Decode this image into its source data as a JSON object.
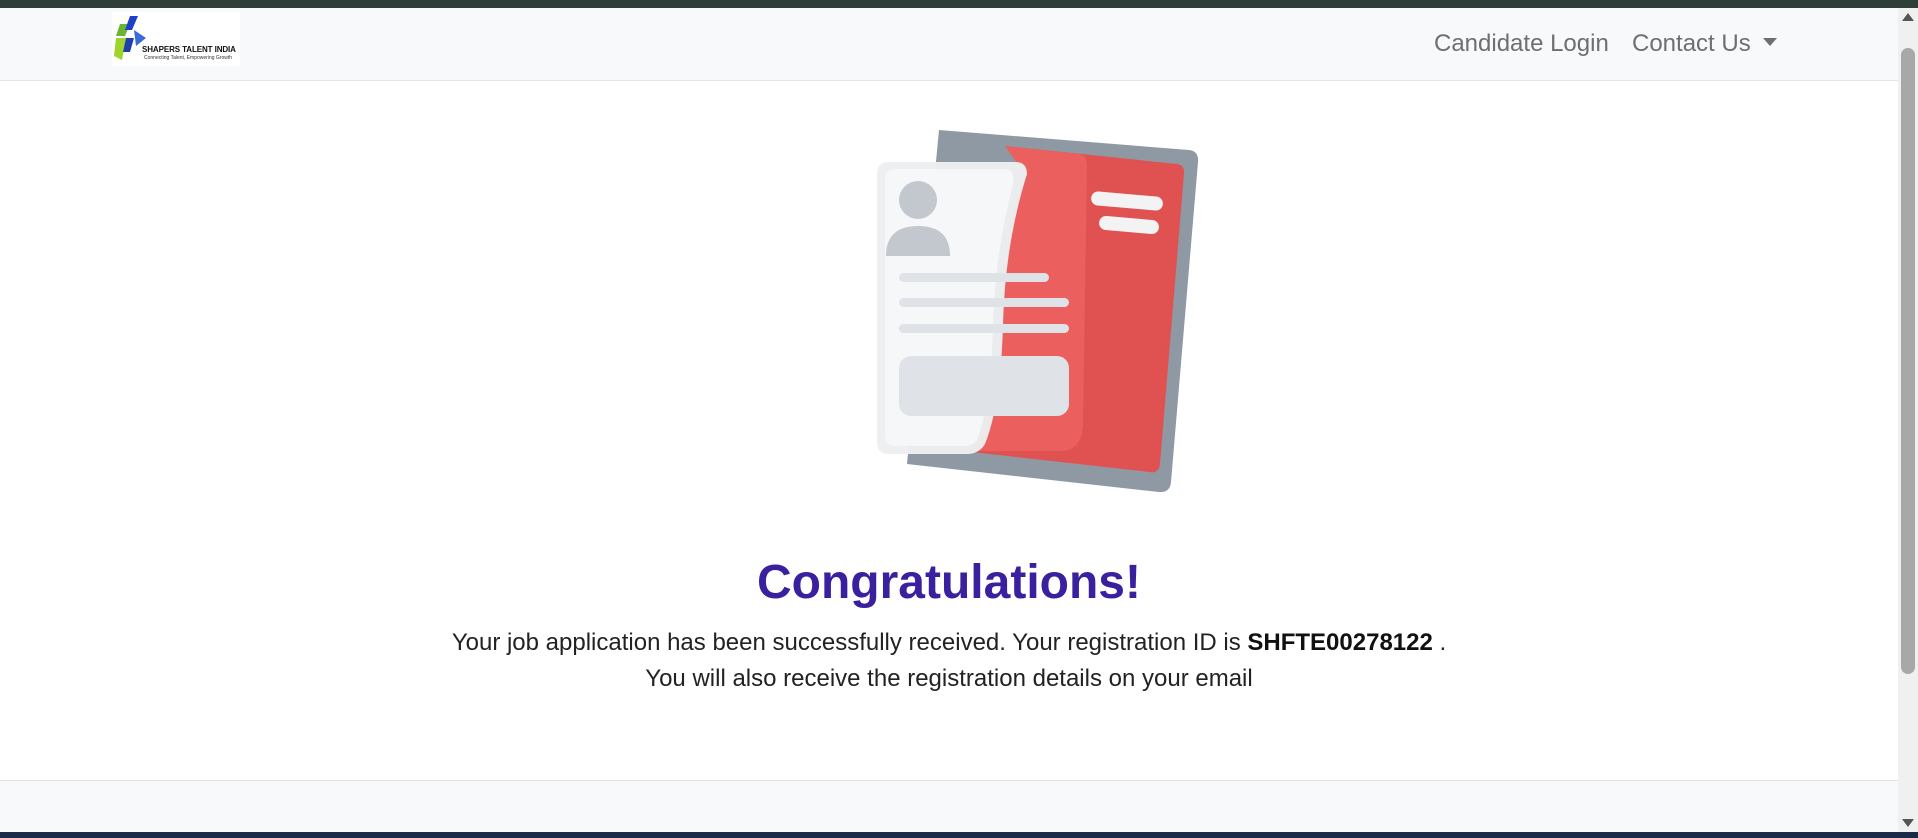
{
  "header": {
    "logo_title": "SHAPERS TALENT INDIA",
    "logo_tagline": "Connecting Talent, Empowering Growth",
    "nav": {
      "candidate_login": "Candidate Login",
      "contact_us": "Contact Us"
    }
  },
  "main": {
    "title": "Congratulations!",
    "message_prefix": "Your job application has been successfully received. Your registration ID is",
    "registration_id": "SHFTE00278122",
    "message_suffix": " .",
    "message_line2": "You will also receive the registration details on your email"
  },
  "colors": {
    "title": "#3a1f9f",
    "card_red": "#e05555",
    "card_gray": "#8f99a3",
    "navbar_bg": "#f8f9fa"
  }
}
